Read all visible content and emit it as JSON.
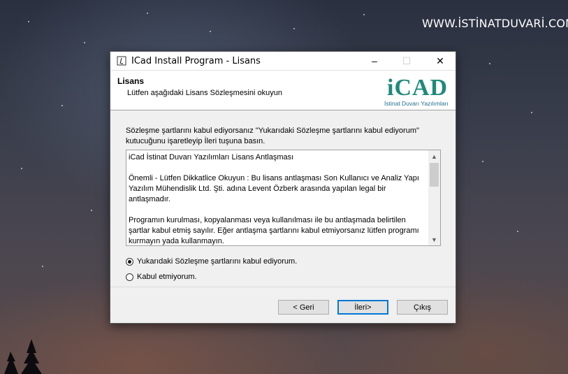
{
  "watermark": "WWW.İSTİNATDUVARİ.COM",
  "window": {
    "title": "ICad Install Program - Lisans",
    "controls": {
      "minimize": "–",
      "maximize": "☐",
      "close": "✕"
    }
  },
  "header": {
    "title": "Lisans",
    "subtitle": "Lütfen aşağıdaki Lisans Sözleşmesini okuyun",
    "logo_text": "iCAD",
    "logo_sub": "İstinat Duvarı Yazılımları"
  },
  "instruction": "Sözleşme şartlarını kabul ediyorsanız  \"Yukarıdaki Sözleşme şartlarını kabul ediyorum\" kutucuğunu işaretleyip İleri tuşuna basın.",
  "license": {
    "line1": "iCad İstinat Duvarı Yazılımları Lisans Antlaşması",
    "line2": "Önemli - Lütfen Dikkatlice Okuyun :  Bu lisans antlaşması Son Kullanıcı ve Analiz Yapı Yazılım Mühendislik Ltd. Şti.  adına Levent Özberk arasında yapılan legal bir antlaşmadır.",
    "line3": "Programın kurulması, kopyalanması veya kullanılması ile bu antlaşmada belirtilen şartlar kabul etmiş sayılır. Eğer antlaşma şartlarını kabul etmiyorsanız lütfen programı kurmayın yada kullanmayın."
  },
  "options": {
    "accept": "Yukarıdaki Sözleşme şartlarını kabul ediyorum.",
    "decline": "Kabul etmiyorum.",
    "selected": "accept"
  },
  "buttons": {
    "back": "< Geri",
    "next": "İleri>",
    "exit": "Çıkış"
  },
  "colors": {
    "logo": "#1f8a7a",
    "default_button_border": "#0078d7"
  }
}
